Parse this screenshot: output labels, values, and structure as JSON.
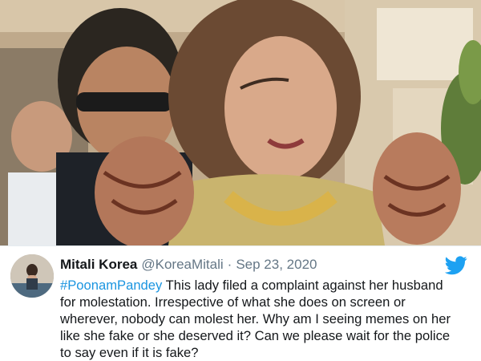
{
  "tweet": {
    "display_name": "Mitali Korea",
    "handle": "@KoreaMitali",
    "separator": "·",
    "date": "Sep 23, 2020",
    "hashtag": "#PoonamPandey",
    "lines": [
      " This lady filed a complaint against her husband",
      "for molestation. Irrespective of what she does on screen or",
      "wherever, nobody can molest her. Why am I seeing memes on her",
      "like she fake or she deserved it? Can we please wait for the police",
      "to say even if it is fake?"
    ]
  },
  "icons": {
    "brand": "twitter-bird-icon"
  },
  "colors": {
    "hashtag": "#1b95e0",
    "twitter_blue": "#1da1f2",
    "text": "#14171a",
    "muted": "#657786"
  }
}
